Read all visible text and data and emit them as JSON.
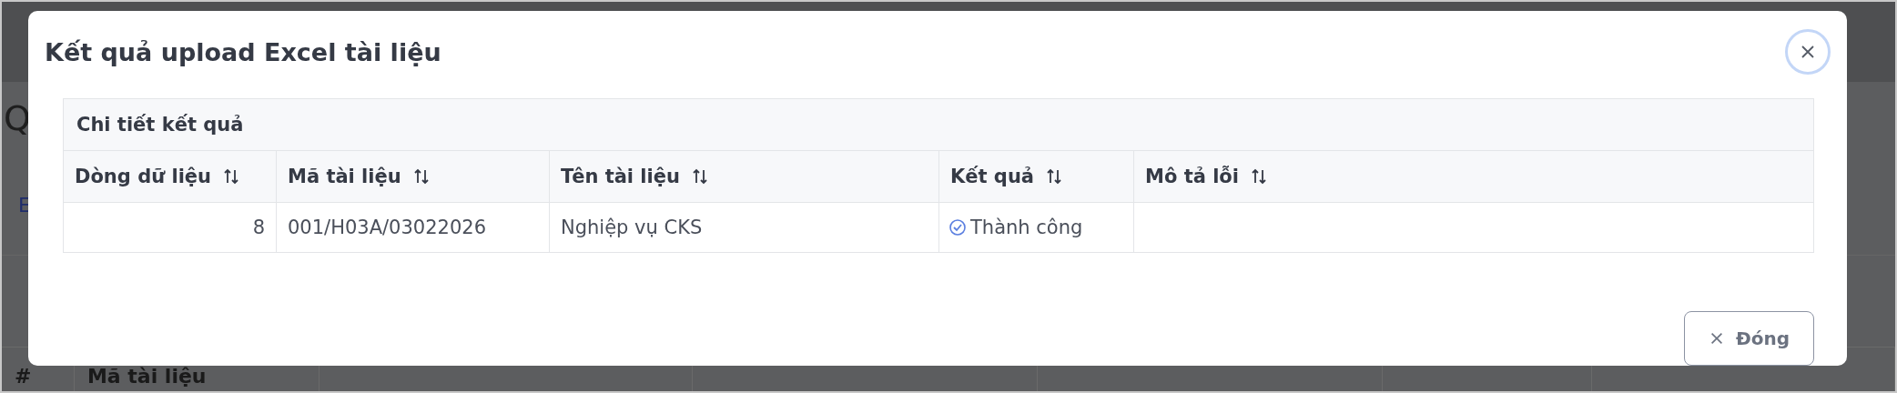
{
  "background_page": {
    "title_fragment": "Q",
    "tab_fragment": "E",
    "table_columns": [
      {
        "label": "#"
      },
      {
        "label": "Mã tài liệu"
      }
    ]
  },
  "dialog": {
    "title": "Kết quả upload Excel tài liệu",
    "section_title": "Chi tiết kết quả",
    "columns": [
      {
        "label": "Dòng dữ liệu"
      },
      {
        "label": "Mã tài liệu"
      },
      {
        "label": "Tên tài liệu"
      },
      {
        "label": "Kết quả"
      },
      {
        "label": "Mô tả lỗi"
      }
    ],
    "rows": [
      {
        "row_number": "8",
        "code": "001/H03A/03022026",
        "name": "Nghiệp vụ CKS",
        "result": {
          "kind": "success",
          "label": "Thành công"
        }
      }
    ],
    "close_button": "Đóng"
  }
}
